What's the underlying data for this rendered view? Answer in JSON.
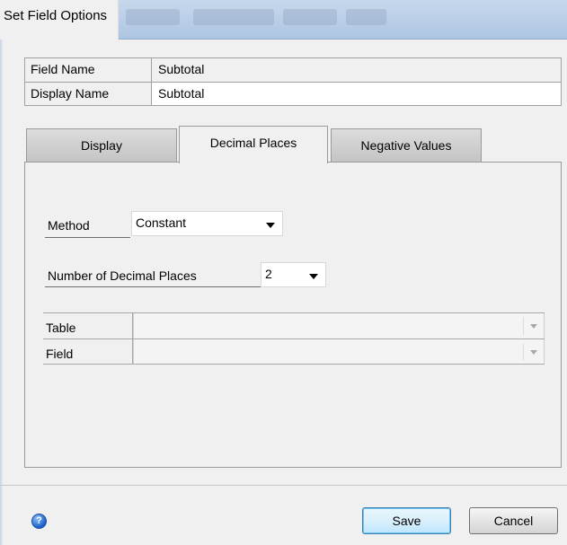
{
  "window": {
    "title": "Set Field Options"
  },
  "fields": {
    "field_name_label": "Field Name",
    "field_name_value": "Subtotal",
    "display_name_label": "Display Name",
    "display_name_value": "Subtotal"
  },
  "tabs": [
    {
      "label": "Display",
      "active": false
    },
    {
      "label": "Decimal Places",
      "active": true
    },
    {
      "label": "Negative Values",
      "active": false
    }
  ],
  "decimal_places": {
    "method_label": "Method",
    "method_value": "Constant",
    "count_label": "Number of Decimal Places",
    "count_value": "2",
    "table_label": "Table",
    "table_value": "",
    "field_label": "Field",
    "field_value": ""
  },
  "footer": {
    "help_icon": "help-icon",
    "help_glyph": "?",
    "save_label": "Save",
    "cancel_label": "Cancel"
  }
}
